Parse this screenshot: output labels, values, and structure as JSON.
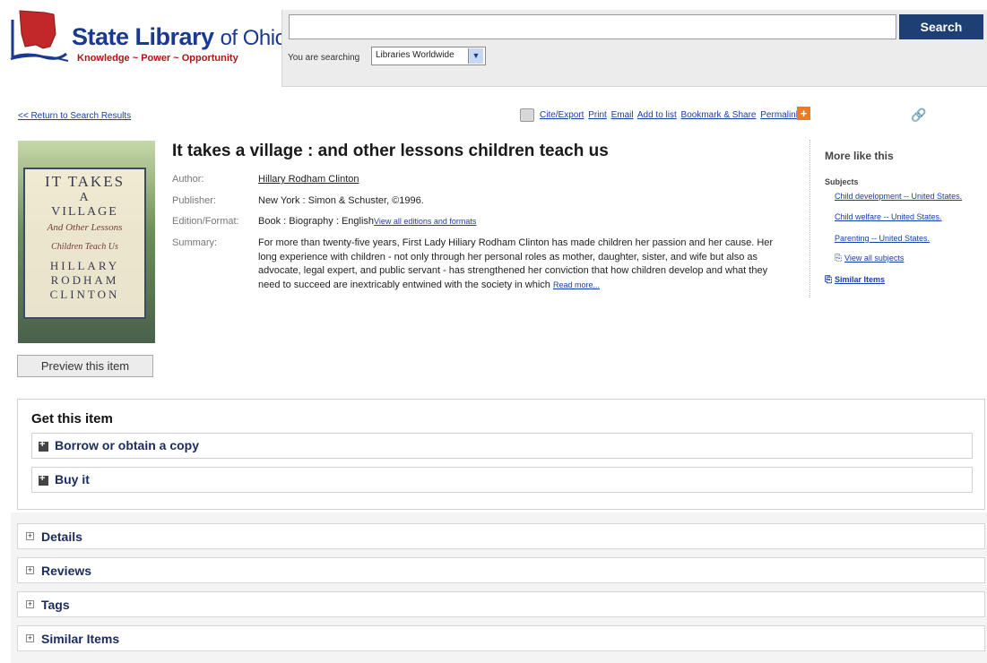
{
  "header": {
    "logo_main": "State Library",
    "logo_of": "of Ohio",
    "logo_tagline": "Knowledge ~ Power ~ Opportunity",
    "search_value": "",
    "search_button": "Search",
    "searching_label": "You are searching",
    "scope_selected": "Libraries Worldwide"
  },
  "toolbar": {
    "return_link": "<< Return to Search Results",
    "cite_export": "Cite/Export",
    "print": "Print",
    "email": "Email",
    "add_to_list": "Add to list",
    "bookmark_share": "Bookmark & Share",
    "permalink": "Permalink"
  },
  "cover": {
    "line1": "IT TAKES",
    "line2": "A",
    "line3": "VILLAGE",
    "line4": "And Other Lessons",
    "line5": "Children Teach Us",
    "line6": "HILLARY",
    "line7": "RODHAM",
    "line8": "CLINTON"
  },
  "record": {
    "title": "It takes a village : and other lessons children teach us",
    "author_label": "Author:",
    "author_value": "Hillary Rodham Clinton",
    "publisher_label": "Publisher:",
    "publisher_value": "New York : Simon & Schuster, ©1996.",
    "edition_label": "Edition/Format:",
    "edition_value": "Book : Biography : English",
    "edition_link": "View all editions and formats",
    "summary_label": "Summary:",
    "summary_text": "For more than twenty-five years, First Lady Hiliary Rodham Clinton has made children her passion and her cause. Her long experience with children - not only through her personal roles as mother, daughter, sister, and wife but also as advocate, legal expert, and public servant - has strengthened her conviction that how children develop and what they need to succeed are inextricably entwined with the society in which ",
    "read_more": "Read more...",
    "preview_button": "Preview this item"
  },
  "more_like_this": {
    "title": "More like this",
    "subjects_label": "Subjects",
    "subjects": [
      "Child development -- United States.",
      "Child welfare -- United States.",
      "Parenting -- United States."
    ],
    "view_all": "View all subjects",
    "similar_items": "Similar Items"
  },
  "get_item": {
    "title": "Get this item",
    "options": [
      "Borrow or obtain a copy",
      "Buy it"
    ]
  },
  "sections": [
    "Details",
    "Reviews",
    "Tags",
    "Similar Items"
  ],
  "colors": {
    "search_button": "#1d3f73",
    "link": "#1a3ea8",
    "logo_blue": "#1a3a8f",
    "logo_red": "#b01515",
    "accent_orange": "#f07a20"
  }
}
